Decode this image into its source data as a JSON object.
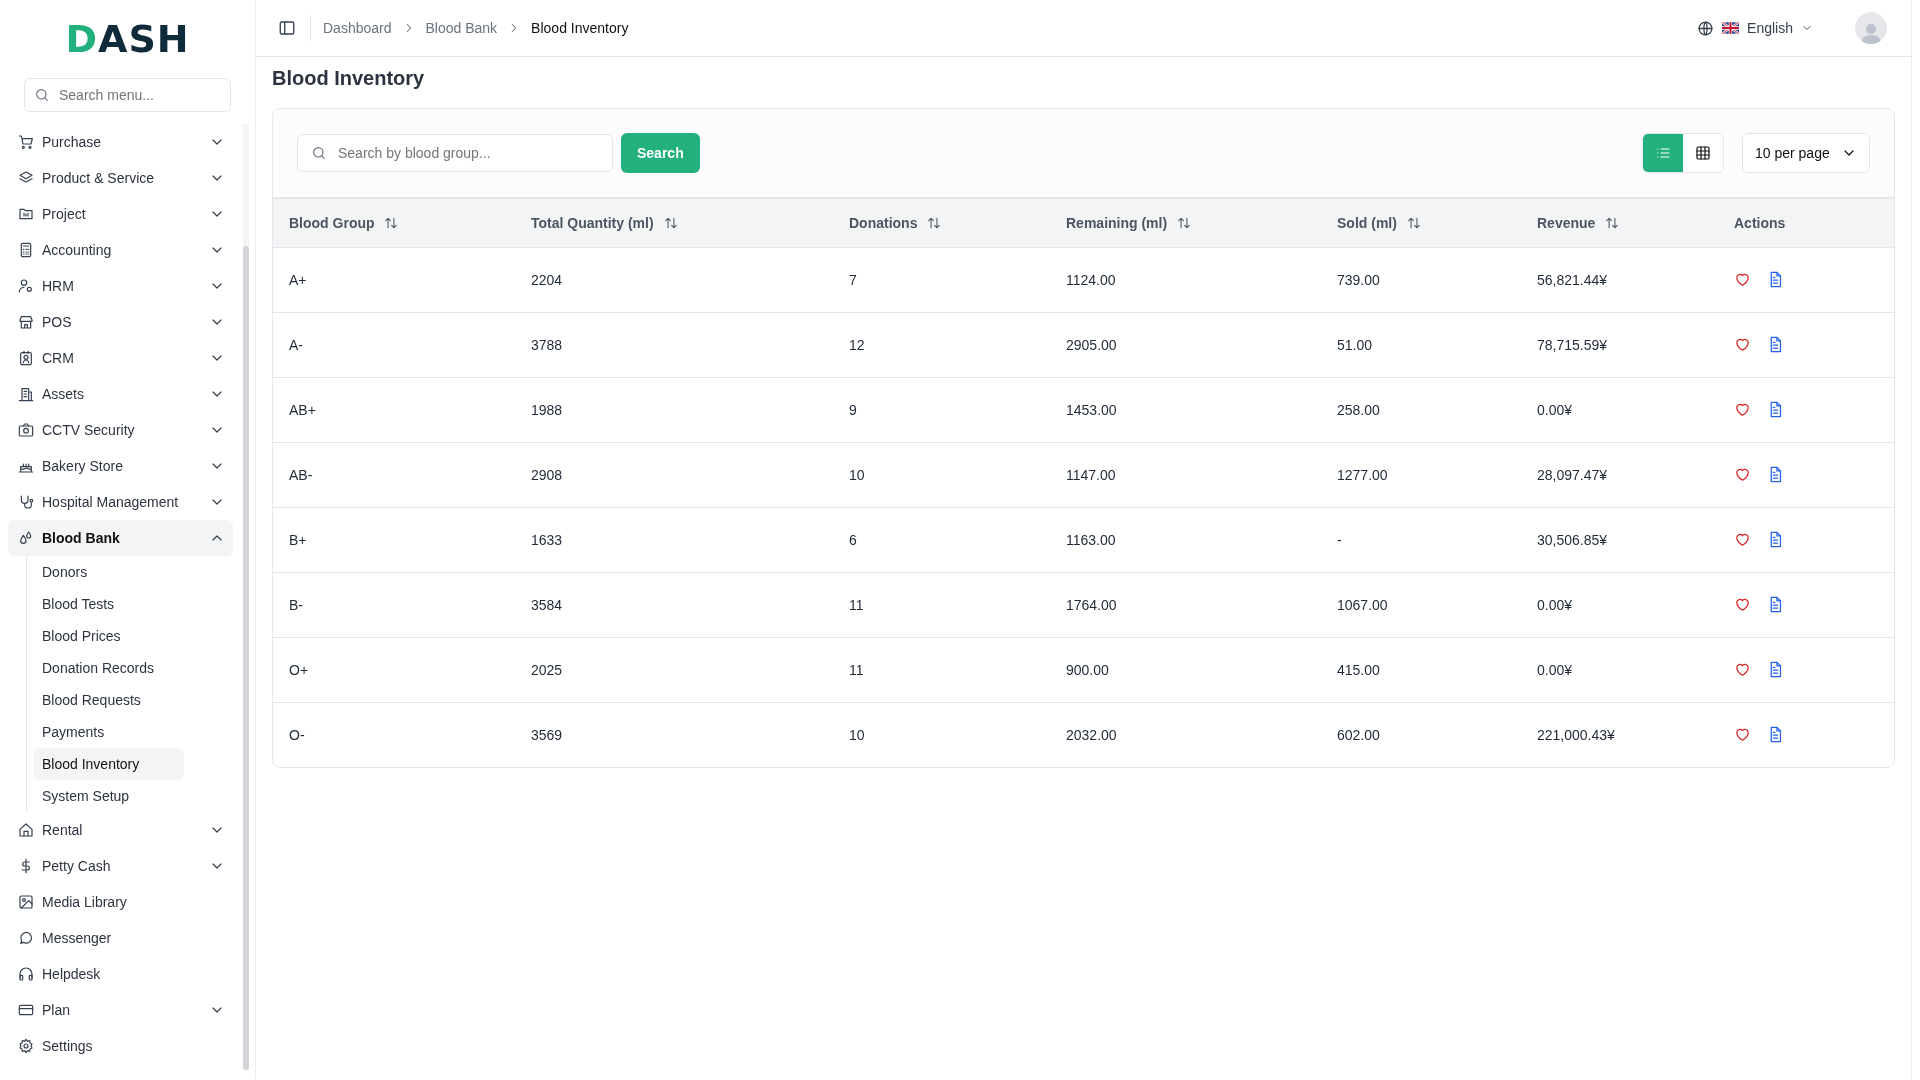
{
  "sidebar": {
    "logo": "DASH",
    "search_placeholder": "Search menu...",
    "items": [
      {
        "label": "Purchase",
        "expandable": true,
        "expanded": false
      },
      {
        "label": "Product & Service",
        "expandable": true,
        "expanded": false
      },
      {
        "label": "Project",
        "expandable": true,
        "expanded": false
      },
      {
        "label": "Accounting",
        "expandable": true,
        "expanded": false
      },
      {
        "label": "HRM",
        "expandable": true,
        "expanded": false
      },
      {
        "label": "POS",
        "expandable": true,
        "expanded": false
      },
      {
        "label": "CRM",
        "expandable": true,
        "expanded": false
      },
      {
        "label": "Assets",
        "expandable": true,
        "expanded": false
      },
      {
        "label": "CCTV Security",
        "expandable": true,
        "expanded": false
      },
      {
        "label": "Bakery Store",
        "expandable": true,
        "expanded": false
      },
      {
        "label": "Hospital Management",
        "expandable": true,
        "expanded": false
      },
      {
        "label": "Blood Bank",
        "expandable": true,
        "expanded": true,
        "children": [
          {
            "label": "Donors",
            "selected": false
          },
          {
            "label": "Blood Tests",
            "selected": false
          },
          {
            "label": "Blood Prices",
            "selected": false
          },
          {
            "label": "Donation Records",
            "selected": false
          },
          {
            "label": "Blood Requests",
            "selected": false
          },
          {
            "label": "Payments",
            "selected": false
          },
          {
            "label": "Blood Inventory",
            "selected": true
          },
          {
            "label": "System Setup",
            "selected": false
          }
        ]
      },
      {
        "label": "Rental",
        "expandable": true,
        "expanded": false
      },
      {
        "label": "Petty Cash",
        "expandable": true,
        "expanded": false
      },
      {
        "label": "Media Library",
        "expandable": false,
        "expanded": false
      },
      {
        "label": "Messenger",
        "expandable": false,
        "expanded": false
      },
      {
        "label": "Helpdesk",
        "expandable": false,
        "expanded": false
      },
      {
        "label": "Plan",
        "expandable": true,
        "expanded": false
      },
      {
        "label": "Settings",
        "expandable": false,
        "expanded": false
      }
    ]
  },
  "topbar": {
    "breadcrumbs": [
      "Dashboard",
      "Blood Bank",
      "Blood Inventory"
    ],
    "language": "English"
  },
  "page_title": "Blood Inventory",
  "toolbar": {
    "search_placeholder": "Search by blood group...",
    "search_button": "Search",
    "views": [
      {
        "selected": true
      },
      {
        "selected": false
      }
    ],
    "per_page": "10 per page"
  },
  "table": {
    "columns": [
      {
        "label": "Blood Group",
        "sortable": true
      },
      {
        "label": "Total Quantity (ml)",
        "sortable": true
      },
      {
        "label": "Donations",
        "sortable": true
      },
      {
        "label": "Remaining (ml)",
        "sortable": true
      },
      {
        "label": "Sold (ml)",
        "sortable": true
      },
      {
        "label": "Revenue",
        "sortable": true
      },
      {
        "label": "Actions",
        "sortable": false
      }
    ],
    "rows": [
      {
        "cells": [
          "A+",
          "2204",
          "7",
          "1124.00",
          "739.00",
          "56,821.44¥"
        ]
      },
      {
        "cells": [
          "A-",
          "3788",
          "12",
          "2905.00",
          "51.00",
          "78,715.59¥"
        ]
      },
      {
        "cells": [
          "AB+",
          "1988",
          "9",
          "1453.00",
          "258.00",
          "0.00¥"
        ]
      },
      {
        "cells": [
          "AB-",
          "2908",
          "10",
          "1147.00",
          "1277.00",
          "28,097.47¥"
        ]
      },
      {
        "cells": [
          "B+",
          "1633",
          "6",
          "1163.00",
          "-",
          "30,506.85¥"
        ]
      },
      {
        "cells": [
          "B-",
          "3584",
          "11",
          "1764.00",
          "1067.00",
          "0.00¥"
        ]
      },
      {
        "cells": [
          "O+",
          "2025",
          "11",
          "900.00",
          "415.00",
          "0.00¥"
        ]
      },
      {
        "cells": [
          "O-",
          "3569",
          "10",
          "2032.00",
          "602.00",
          "221,000.43¥"
        ]
      }
    ]
  }
}
